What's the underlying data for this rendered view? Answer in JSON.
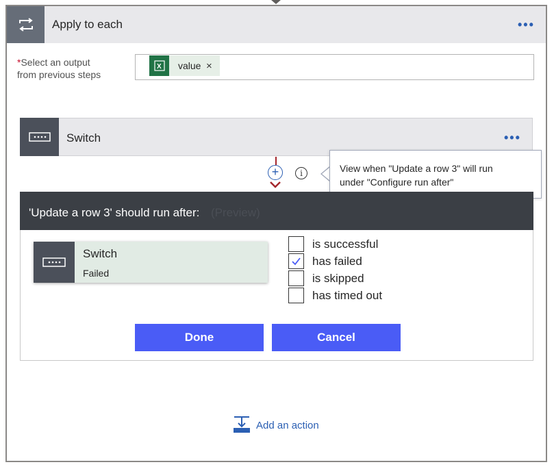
{
  "apply_each": {
    "title": "Apply to each",
    "menu_dots": "•••",
    "icon": "loop-icon",
    "select_label_required_mark": "*",
    "select_label_line1": "Select an output",
    "select_label_line2": "from previous steps",
    "token": {
      "label": "value",
      "remove": "×",
      "icon": "excel-icon"
    }
  },
  "switch_card": {
    "title": "Switch",
    "menu_dots": "•••",
    "icon": "switch-icon"
  },
  "connector": {
    "plus": "+",
    "info": "i"
  },
  "tooltip": {
    "line1": "View when \"Update a row 3\" will run",
    "line2": "under \"Configure run after\""
  },
  "run_after": {
    "title": "'Update a row 3' should run after:",
    "preview": "(Preview)",
    "node": {
      "title": "Switch",
      "status": "Failed",
      "icon": "switch-icon"
    },
    "options": [
      {
        "label": "is successful",
        "checked": false
      },
      {
        "label": "has failed",
        "checked": true
      },
      {
        "label": "is skipped",
        "checked": false
      },
      {
        "label": "has timed out",
        "checked": false
      }
    ],
    "done_label": "Done",
    "cancel_label": "Cancel"
  },
  "add_action": {
    "label": "Add an action",
    "icon": "add-action-icon"
  },
  "colors": {
    "primary_button": "#4a5cf6",
    "link": "#2b5fb3",
    "header_dark": "#3b3f45",
    "required": "#c8102e",
    "connector": "#a4262c"
  }
}
